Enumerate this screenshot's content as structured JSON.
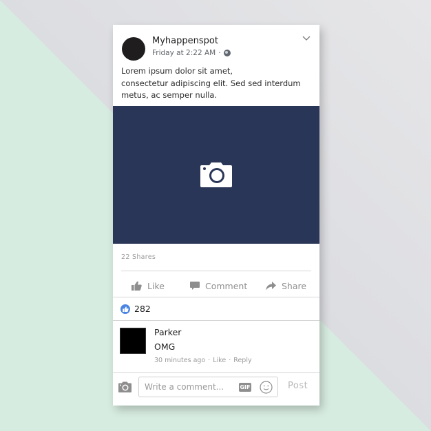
{
  "post": {
    "author": "Myhappenspot",
    "timestamp": "Friday at 2:22 AM",
    "separator": "·",
    "privacy_icon": "globe-icon",
    "menu_icon": "chevron-down-icon",
    "text": "Lorem ipsum dolor sit amet,\nconsectetur adipiscing elit. Sed sed interdum metus, ac semper nulla.",
    "text_lines": [
      "Lorem ipsum dolor sit amet,",
      "consectetur adipiscing elit. Sed sed interdum",
      "metus, ac semper nulla."
    ],
    "photo_icon": "camera-icon",
    "photo_bg_color": "#2a3657",
    "shares": "22 Shares"
  },
  "actions": {
    "like": "Like",
    "comment": "Comment",
    "share": "Share"
  },
  "reactions": {
    "count": "282",
    "color": "#4a84e4"
  },
  "comments": [
    {
      "name": "Parker",
      "text": "OMG",
      "time": "30 minutes ago",
      "like": "Like",
      "reply": "Reply",
      "separator": "·"
    }
  ],
  "composer": {
    "placeholder": "Write a comment...",
    "gif_label": "GIF",
    "post_label": "Post"
  },
  "background": {
    "mint": "#d7ece0",
    "gray": "#dcdde1"
  }
}
